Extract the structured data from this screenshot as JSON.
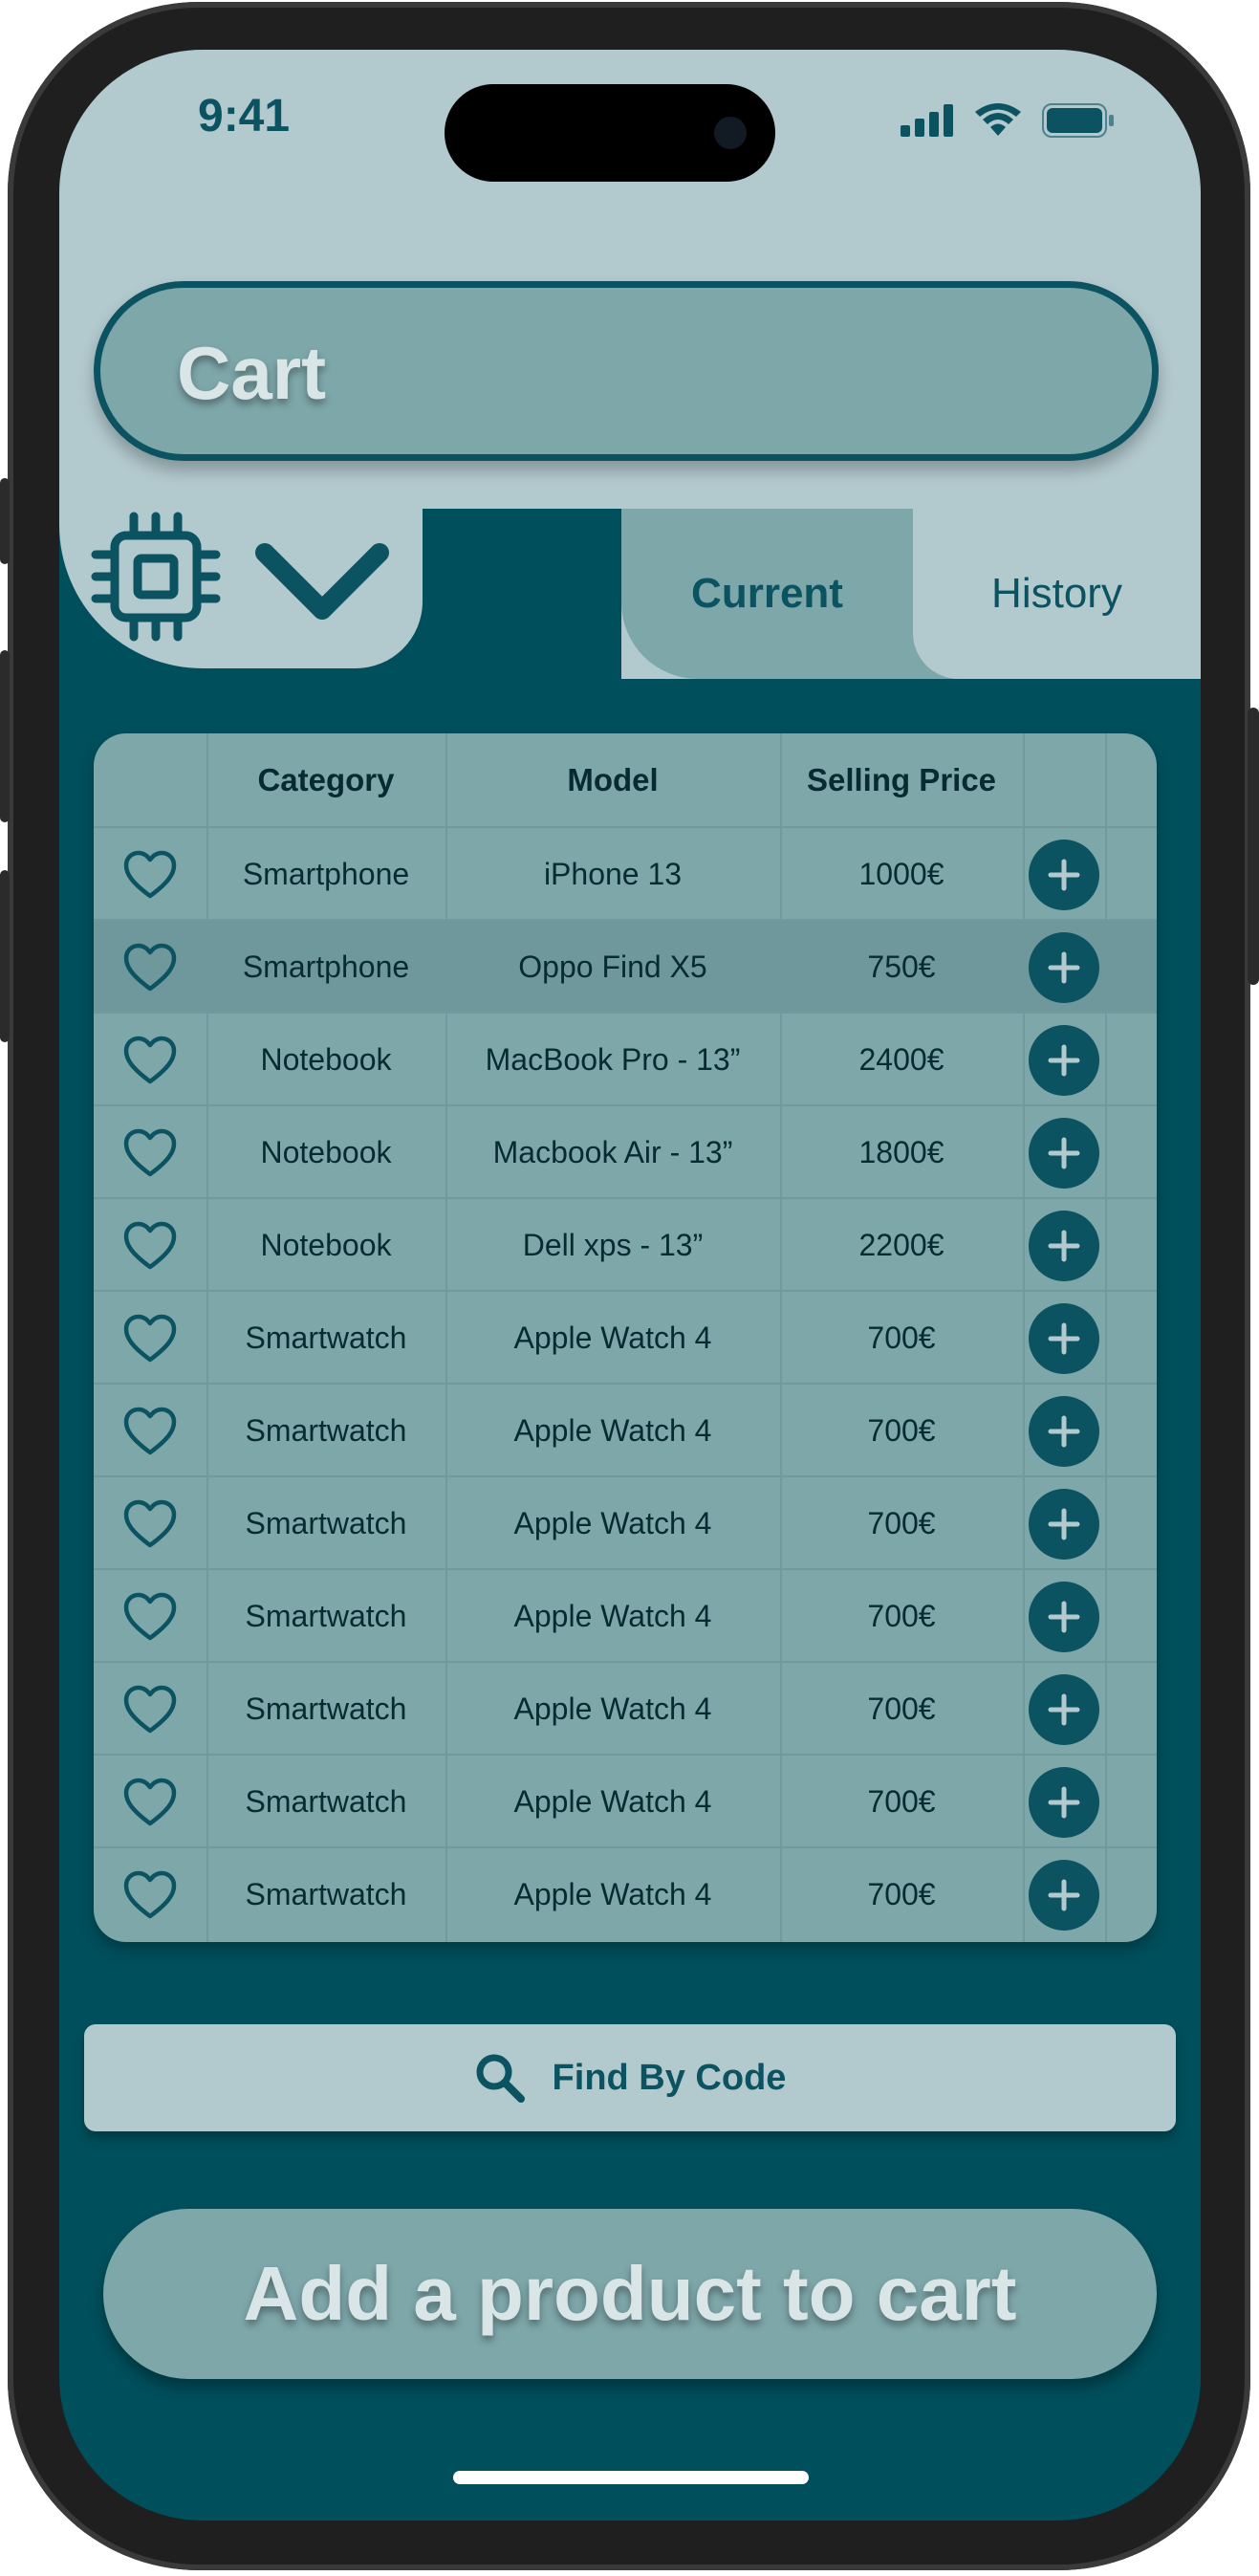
{
  "status_bar": {
    "time": "9:41"
  },
  "header": {
    "title": "Cart"
  },
  "tabs": [
    {
      "label": "Current",
      "active": true
    },
    {
      "label": "History",
      "active": false
    }
  ],
  "table": {
    "columns": [
      "",
      "Category",
      "Model",
      "Selling Price",
      ""
    ],
    "rows": [
      {
        "category": "Smartphone",
        "model": "iPhone 13",
        "price": "1000€"
      },
      {
        "category": "Smartphone",
        "model": "Oppo Find X5",
        "price": "750€"
      },
      {
        "category": "Notebook",
        "model": "MacBook Pro - 13”",
        "price": "2400€"
      },
      {
        "category": "Notebook",
        "model": "Macbook Air - 13”",
        "price": "1800€"
      },
      {
        "category": "Notebook",
        "model": "Dell xps - 13”",
        "price": "2200€"
      },
      {
        "category": "Smartwatch",
        "model": "Apple Watch 4",
        "price": "700€"
      },
      {
        "category": "Smartwatch",
        "model": "Apple Watch 4",
        "price": "700€"
      },
      {
        "category": "Smartwatch",
        "model": "Apple Watch 4",
        "price": "700€"
      },
      {
        "category": "Smartwatch",
        "model": "Apple Watch 4",
        "price": "700€"
      },
      {
        "category": "Smartwatch",
        "model": "Apple Watch 4",
        "price": "700€"
      },
      {
        "category": "Smartwatch",
        "model": "Apple Watch 4",
        "price": "700€"
      },
      {
        "category": "Smartwatch",
        "model": "Apple Watch 4",
        "price": "700€"
      }
    ]
  },
  "find_button": {
    "label": "Find By Code",
    "icon": "search-icon"
  },
  "add_button": {
    "label": "Add a product to cart"
  },
  "colors": {
    "dark_teal": "#004f5c",
    "light_teal": "#b2c9ce",
    "mid_teal": "#7ea7aa",
    "accent": "#0c5362"
  }
}
